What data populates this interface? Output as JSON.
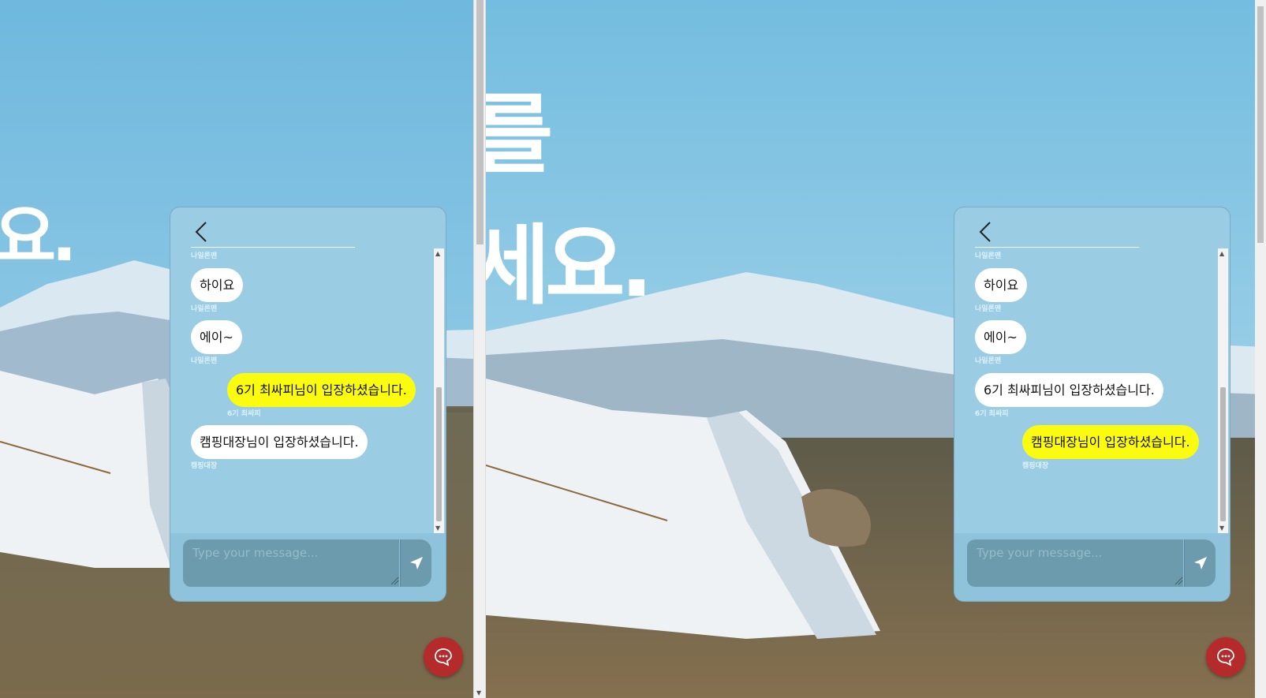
{
  "hero": {
    "left_line": "요.",
    "right_line1": "를",
    "right_line2": "세요."
  },
  "chat_left": {
    "messages": [
      {
        "sender": "나일론맨",
        "text": ""
      },
      {
        "sender": "나일론맨",
        "text": "하이요",
        "mine": false
      },
      {
        "sender": "나일론맨",
        "text": "에이~",
        "mine": false
      },
      {
        "sender": "6기 최싸피",
        "text": "6기 최싸피님이 입장하셨습니다.",
        "mine": true
      },
      {
        "sender": "캠핑대장",
        "text": "캠핑대장님이 입장하셨습니다.",
        "mine": false
      }
    ],
    "input_placeholder": "Type your message..."
  },
  "chat_right": {
    "messages": [
      {
        "sender": "나일론맨",
        "text": ""
      },
      {
        "sender": "나일론맨",
        "text": "하이요",
        "mine": false
      },
      {
        "sender": "나일론맨",
        "text": "에이~",
        "mine": false
      },
      {
        "sender": "6기 최싸피",
        "text": "6기 최싸피님이 입장하셨습니다.",
        "mine": false
      },
      {
        "sender": "캠핑대장",
        "text": "캠핑대장님이 입장하셨습니다.",
        "mine": true
      }
    ],
    "input_placeholder": "Type your message..."
  },
  "icons": {
    "back": "chevron-left-icon",
    "send": "paper-plane-icon",
    "fab": "chat-bubble-icon"
  },
  "colors": {
    "my_bubble": "#fbfb10",
    "other_bubble": "#ffffff",
    "chat_panel": "#9acde4",
    "fab": "#b52a2b"
  }
}
